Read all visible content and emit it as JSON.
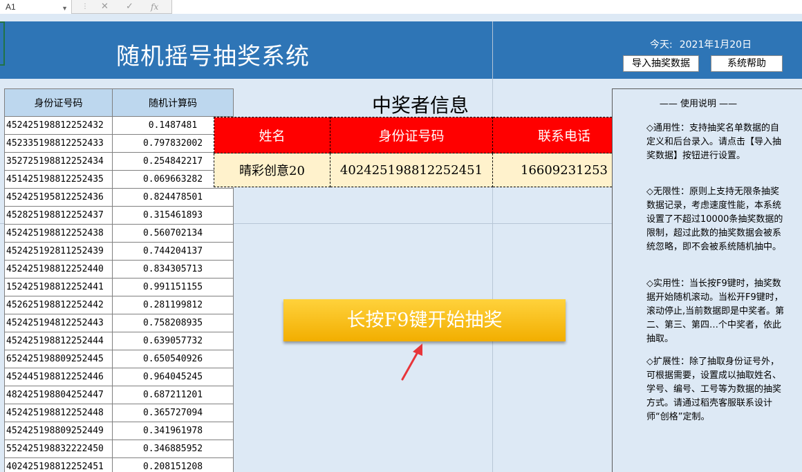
{
  "formula_bar": {
    "cell_ref": "A1",
    "fx_label": "fx"
  },
  "header": {
    "title": "随机摇号抽奖系统",
    "today_label": "今天:",
    "today_value": "2021年1月20日",
    "import_button": "导入抽奖数据",
    "help_button": "系统帮助"
  },
  "id_table": {
    "columns": [
      "身份证号码",
      "随机计算码"
    ],
    "rows": [
      [
        "452425198812252432",
        "0.1487481"
      ],
      [
        "452335198812252433",
        "0.797832002"
      ],
      [
        "352725198812252434",
        "0.254842217"
      ],
      [
        "451425198812252435",
        "0.069663282"
      ],
      [
        "452425195812252436",
        "0.824478501"
      ],
      [
        "452825198812252437",
        "0.315461893"
      ],
      [
        "452425198812252438",
        "0.560702134"
      ],
      [
        "452425192811252439",
        "0.744204137"
      ],
      [
        "452425198812252440",
        "0.834305713"
      ],
      [
        "152425198812252441",
        "0.991151155"
      ],
      [
        "452625198812252442",
        "0.281199812"
      ],
      [
        "452425194812252443",
        "0.758208935"
      ],
      [
        "452425198812252444",
        "0.639057732"
      ],
      [
        "652425198809252445",
        "0.650540926"
      ],
      [
        "452445198812252446",
        "0.964045245"
      ],
      [
        "482425198804252447",
        "0.687211201"
      ],
      [
        "452425198812252448",
        "0.365727094"
      ],
      [
        "452425198809252449",
        "0.341961978"
      ],
      [
        "552425198832222450",
        "0.346885952"
      ],
      [
        "402425198812252451",
        "0.208151208"
      ]
    ]
  },
  "winner": {
    "title": "中奖者信息",
    "headers": [
      "姓名",
      "身份证号码",
      "联系电话"
    ],
    "values": [
      "晴彩创意20",
      "402425198812252451",
      "16609231253"
    ]
  },
  "start_button": "长按F9键开始抽奖",
  "instructions": {
    "title": "—— 使用说明 ——",
    "paragraphs": [
      "◇通用性：支持抽奖名单数据的自定义和后台录入。请点击【导入抽奖数据】按钮进行设置。",
      "◇无限性：原则上支持无限条抽奖数据记录，考虑速度性能，本系统设置了不超过10000条抽奖数据的限制，超过此数的抽奖数据会被系统忽略，即不会被系统随机抽中。",
      "◇实用性：当长按F9键时，抽奖数据开始随机滚动。当松开F9键时，滚动停止,当前数据即是中奖者。第二、第三、第四…个中奖者，依此抽取。",
      "◇扩展性：除了抽取身份证号外，可根据需要，设置成以抽取姓名、学号、编号、工号等为数据的抽奖方式。请通过稻壳客服联系设计师“创格”定制。"
    ]
  },
  "colors": {
    "header_bg": "#2e75b6",
    "sheet_bg": "#dde9f5",
    "table_header_bg": "#bdd7ee",
    "winner_header_bg": "#ff0000",
    "winner_value_bg": "#fff2cc",
    "button_gold": "#f2ae00",
    "arrow_red": "#e8353a"
  }
}
